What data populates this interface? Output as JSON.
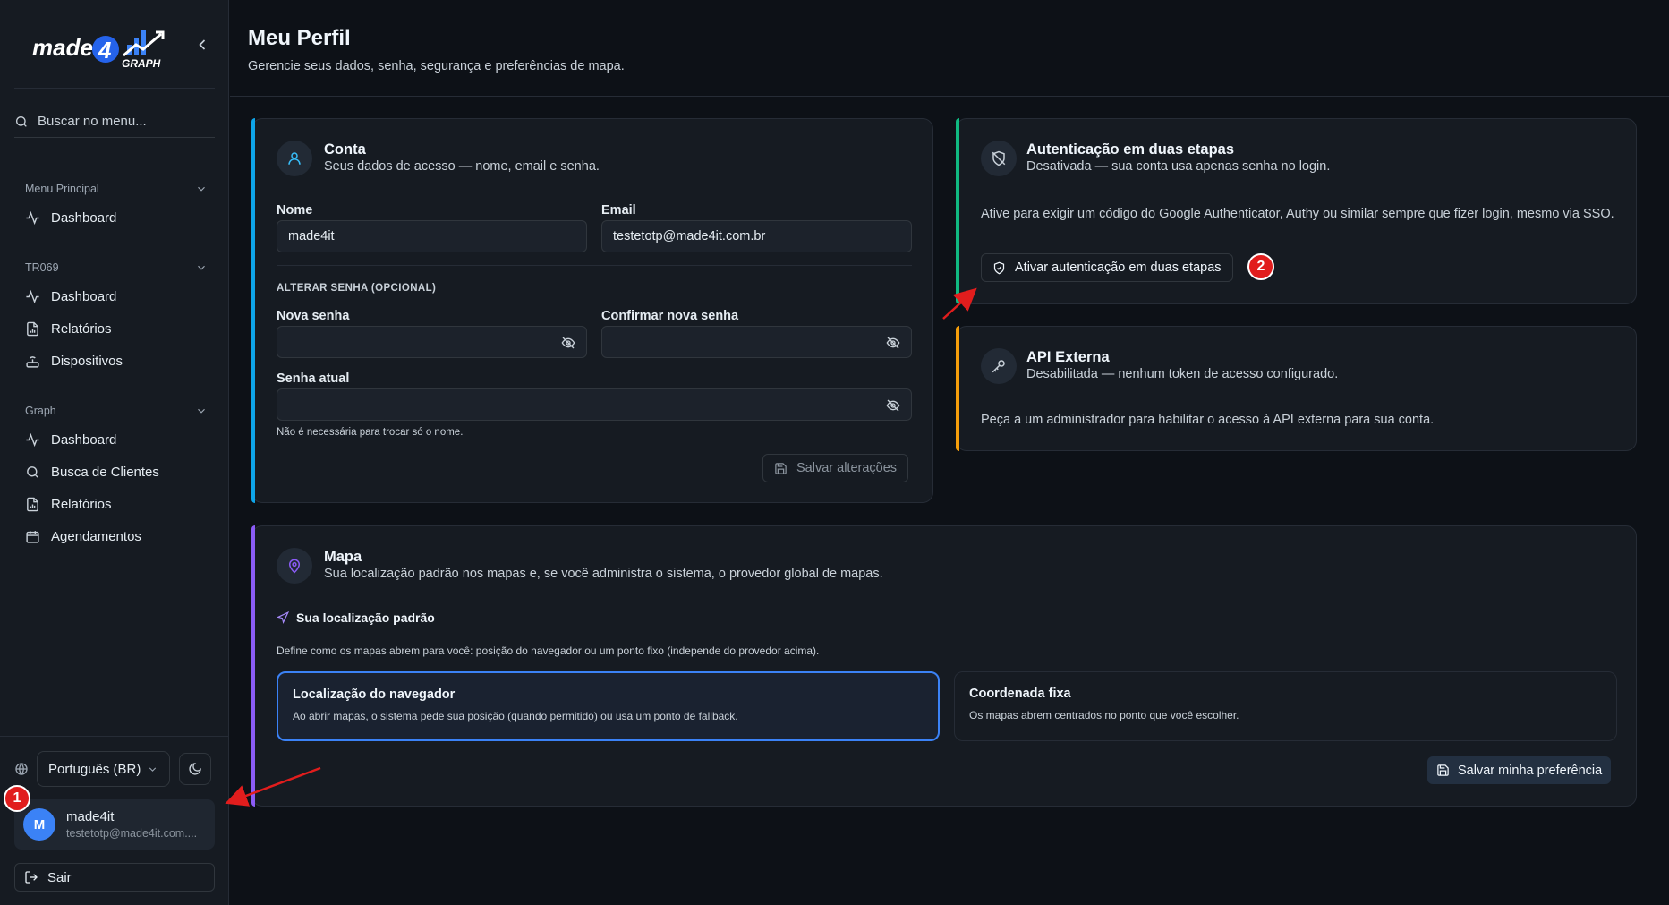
{
  "sidebar": {
    "logo_text": "made4 GRAPH",
    "search_placeholder": "Buscar no menu...",
    "groups": [
      {
        "title": "Menu Principal",
        "items": [
          {
            "label": "Dashboard",
            "icon": "activity-icon"
          }
        ]
      },
      {
        "title": "TR069",
        "items": [
          {
            "label": "Dashboard",
            "icon": "activity-icon"
          },
          {
            "label": "Relatórios",
            "icon": "file-chart-icon"
          },
          {
            "label": "Dispositivos",
            "icon": "router-icon"
          }
        ]
      },
      {
        "title": "Graph",
        "items": [
          {
            "label": "Dashboard",
            "icon": "activity-icon"
          },
          {
            "label": "Busca de Clientes",
            "icon": "search-icon"
          },
          {
            "label": "Relatórios",
            "icon": "file-chart-icon"
          },
          {
            "label": "Agendamentos",
            "icon": "calendar-icon"
          }
        ]
      }
    ],
    "language": "Português (BR)",
    "user": {
      "initial": "M",
      "name": "made4it",
      "email": "testetotp@made4it.com...."
    },
    "logout_label": "Sair"
  },
  "header": {
    "title": "Meu Perfil",
    "subtitle": "Gerencie seus dados, senha, segurança e preferências de mapa."
  },
  "account": {
    "title": "Conta",
    "subtitle": "Seus dados de acesso — nome, email e senha.",
    "name_label": "Nome",
    "name_value": "made4it",
    "email_label": "Email",
    "email_value": "testetotp@made4it.com.br",
    "password_section": "ALTERAR SENHA (OPCIONAL)",
    "new_password_label": "Nova senha",
    "confirm_password_label": "Confirmar nova senha",
    "current_password_label": "Senha atual",
    "current_password_hint": "Não é necessária para trocar só o nome.",
    "save_label": "Salvar alterações"
  },
  "twofa": {
    "title": "Autenticação em duas etapas",
    "subtitle": "Desativada — sua conta usa apenas senha no login.",
    "description": "Ative para exigir um código do Google Authenticator, Authy ou similar sempre que fizer login, mesmo via SSO.",
    "button_label": "Ativar autenticação em duas etapas"
  },
  "api": {
    "title": "API Externa",
    "subtitle": "Desabilitada — nenhum token de acesso configurado.",
    "description": "Peça a um administrador para habilitar o acesso à API externa para sua conta."
  },
  "map": {
    "title": "Mapa",
    "subtitle": "Sua localização padrão nos mapas e, se você administra o sistema, o provedor global de mapas.",
    "section_title": "Sua localização padrão",
    "section_desc": "Define como os mapas abrem para você: posição do navegador ou um ponto fixo (independe do provedor acima).",
    "options": [
      {
        "title": "Localização do navegador",
        "desc": "Ao abrir mapas, o sistema pede sua posição (quando permitido) ou usa um ponto de fallback.",
        "selected": true
      },
      {
        "title": "Coordenada fixa",
        "desc": "Os mapas abrem centrados no ponto que você escolher.",
        "selected": false
      }
    ],
    "save_label": "Salvar minha preferência"
  },
  "annotations": {
    "marker_1": "1",
    "marker_2": "2"
  },
  "colors": {
    "account_accent": "#0ea5e9",
    "twofa_accent": "#10b981",
    "api_accent": "#f59e0b",
    "map_accent": "#8b5cf6",
    "selected_border": "#3b82f6",
    "annotation_red": "#e11d1d"
  }
}
